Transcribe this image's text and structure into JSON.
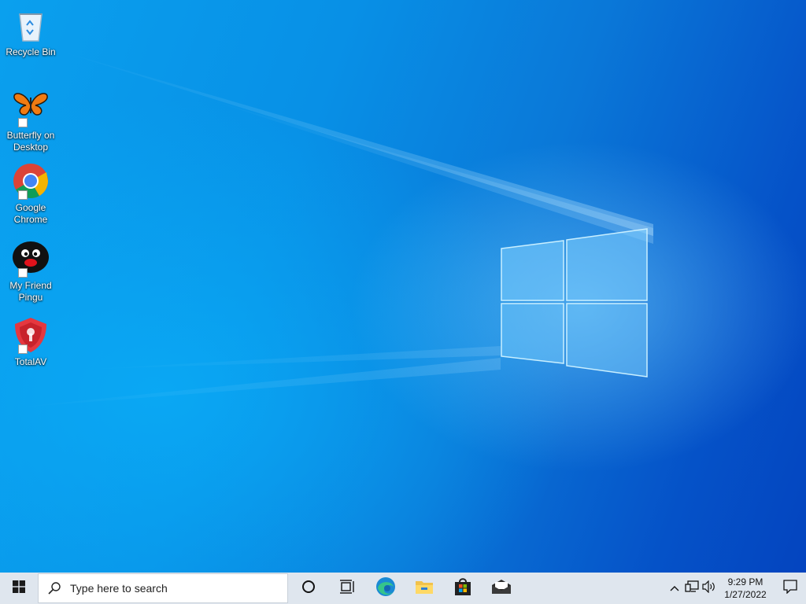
{
  "desktop": {
    "icons": [
      {
        "label": "Recycle Bin",
        "icon": "recycle-bin-icon"
      },
      {
        "label": "Butterfly on Desktop",
        "icon": "butterfly-icon"
      },
      {
        "label": "Google Chrome",
        "icon": "chrome-icon"
      },
      {
        "label": "My Friend Pingu",
        "icon": "pingu-icon"
      },
      {
        "label": "TotalAV",
        "icon": "totalav-shield-icon"
      }
    ]
  },
  "taskbar": {
    "start_icon": "windows-logo-icon",
    "search": {
      "placeholder": "Type here to search",
      "icon": "search-icon"
    },
    "pinned": [
      {
        "name": "Cortana",
        "icon": "cortana-circle-icon"
      },
      {
        "name": "Task View",
        "icon": "task-view-icon"
      },
      {
        "name": "Microsoft Edge",
        "icon": "edge-icon"
      },
      {
        "name": "File Explorer",
        "icon": "file-explorer-icon"
      },
      {
        "name": "Microsoft Store",
        "icon": "store-icon"
      },
      {
        "name": "Mail",
        "icon": "mail-icon"
      }
    ],
    "tray": {
      "time": "9:29 PM",
      "date": "1/27/2022"
    }
  },
  "colors": {
    "taskbar_bg": "#dfe6ee",
    "desktop_blue": "#0a78d6"
  }
}
